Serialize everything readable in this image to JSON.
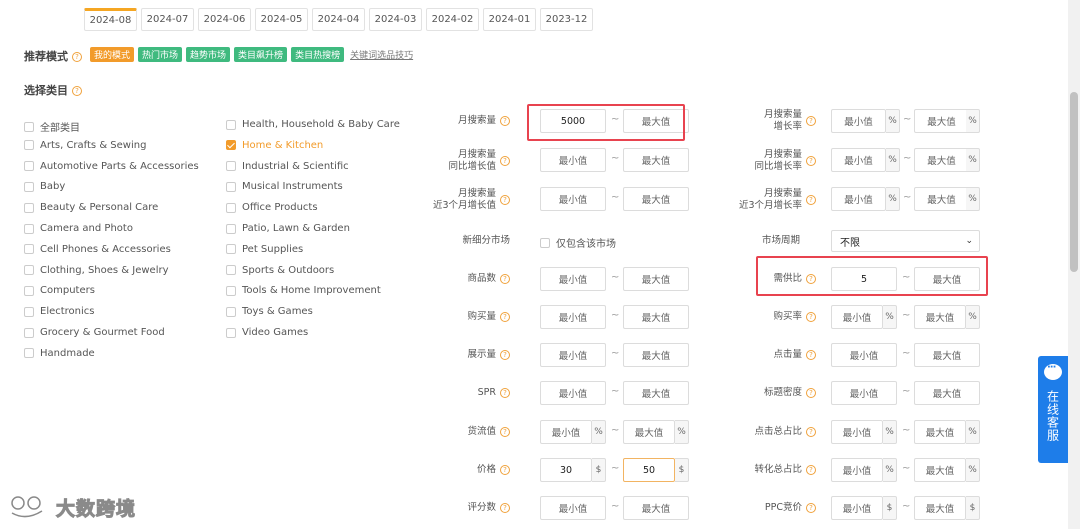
{
  "months": [
    "2024-08",
    "2024-07",
    "2024-06",
    "2024-05",
    "2024-04",
    "2024-03",
    "2024-02",
    "2024-01",
    "2023-12"
  ],
  "recommend": {
    "label": "推荐模式",
    "tags": [
      "我的模式",
      "热门市场",
      "趋势市场",
      "类目飙升榜",
      "类目热搜榜"
    ],
    "link": "关键词选品技巧"
  },
  "category_section": {
    "label": "选择类目"
  },
  "categories_col1": [
    "全部类目",
    "Arts, Crafts & Sewing",
    "Automotive Parts & Accessories",
    "Baby",
    "Beauty & Personal Care",
    "Camera and Photo",
    "Cell Phones & Accessories",
    "Clothing, Shoes & Jewelry",
    "Computers",
    "Electronics",
    "Grocery & Gourmet Food",
    "Handmade"
  ],
  "categories_col2": [
    "Health, Household & Baby Care",
    "Home & Kitchen",
    "Industrial & Scientific",
    "Musical Instruments",
    "Office Products",
    "Patio, Lawn & Garden",
    "Pet Supplies",
    "Sports & Outdoors",
    "Tools & Home Improvement",
    "Toys & Games",
    "Video Games"
  ],
  "selected_category": "Home & Kitchen",
  "placeholders": {
    "min": "最小值",
    "max": "最大值"
  },
  "units": {
    "percent": "%",
    "dollar": "$"
  },
  "dash": "~",
  "left_filters": {
    "monthly_search": {
      "label": "月搜索量",
      "min": "5000"
    },
    "yoy_growth": {
      "label": "月搜索量\n同比增长值"
    },
    "three_month_growth": {
      "label": "月搜索量\n近3个月增长值"
    },
    "new_segment": {
      "label": "新细分市场",
      "checkbox": "仅包含该市场"
    },
    "product_count": {
      "label": "商品数"
    },
    "purchases": {
      "label": "购买量"
    },
    "impressions": {
      "label": "展示量"
    },
    "spr": {
      "label": "SPR"
    },
    "cargo_value": {
      "label": "货流值"
    },
    "price": {
      "label": "价格",
      "min": "30",
      "max": "50"
    },
    "reviews": {
      "label": "评分数"
    }
  },
  "right_filters": {
    "monthly_search_growth_rate": {
      "label": "月搜索量\n增长率"
    },
    "yoy_growth_rate": {
      "label": "月搜索量\n同比增长率"
    },
    "three_month_growth_rate": {
      "label": "月搜索量\n近3个月增长率"
    },
    "market_cycle": {
      "label": "市场周期",
      "value": "不限"
    },
    "supply_demand": {
      "label": "需供比",
      "min": "5"
    },
    "purchase_rate": {
      "label": "购买率"
    },
    "clicks": {
      "label": "点击量"
    },
    "title_density": {
      "label": "标题密度"
    },
    "click_share": {
      "label": "点击总占比"
    },
    "conversion_share": {
      "label": "转化总占比"
    },
    "ppc": {
      "label": "PPC竞价"
    }
  },
  "side_widget": {
    "label": "在线客服"
  },
  "watermark": {
    "text": "大数跨境"
  },
  "colors": {
    "accent": "#f29b2a",
    "green": "#3fba7f",
    "highlight": "#e8434f",
    "widget": "#1e7de9"
  }
}
